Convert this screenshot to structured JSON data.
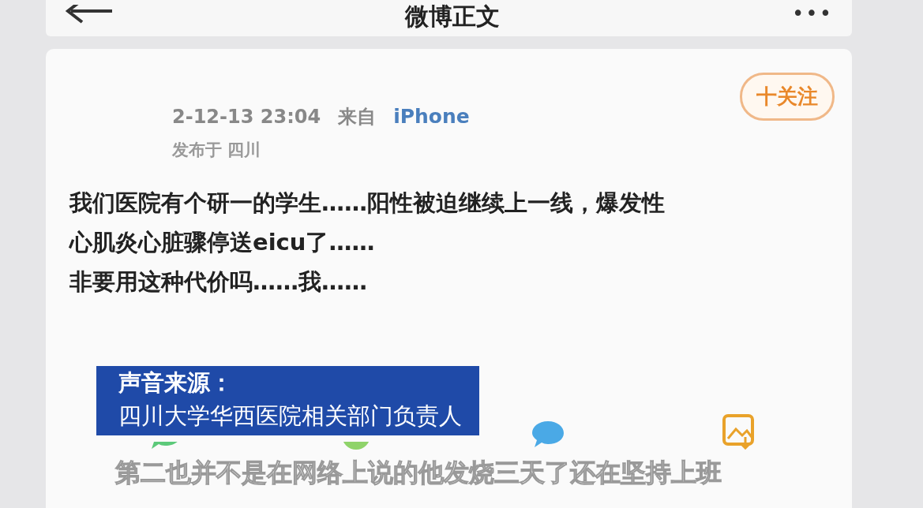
{
  "top_bar": {
    "title": "微博正文",
    "more": "•••"
  },
  "post": {
    "follow_button": "十关注",
    "time": "2-12-13 23:04",
    "from_label": "来自",
    "device": "iPhone",
    "location": "发布于 四川",
    "lines": [
      "我们医院有个研一的学生……阳性被迫继续上一线，爆发性",
      "心肌炎心脏骤停送eicu了……",
      "非要用这种代价吗……我……"
    ]
  },
  "caption": {
    "heading": "声音来源：",
    "speaker": "四川大学华西医院相关部门负责人"
  },
  "subtitle": "第二也并不是在网络上说的他发烧三天了还在坚持上班"
}
